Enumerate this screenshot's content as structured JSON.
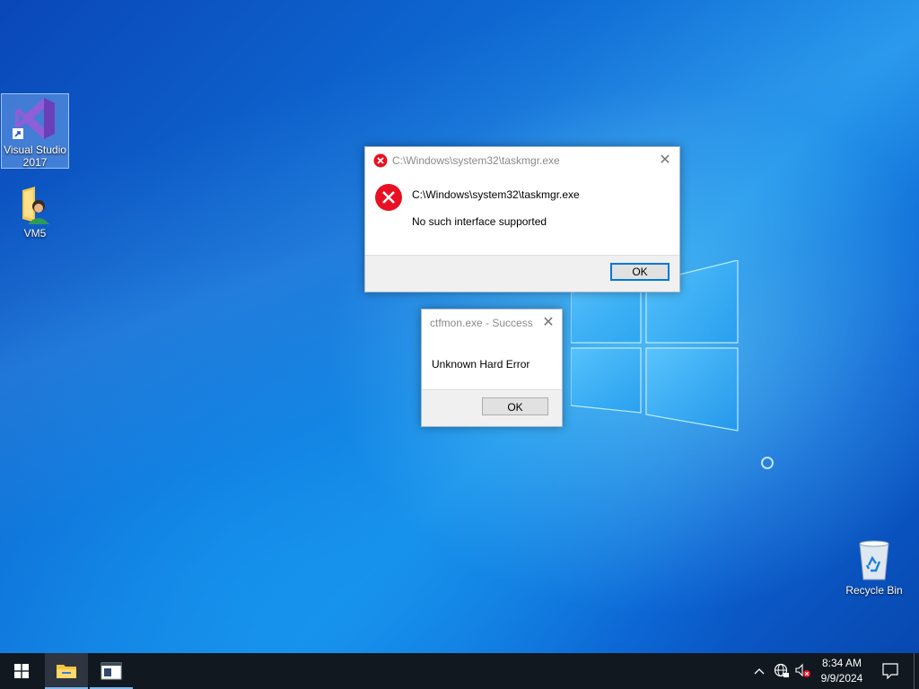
{
  "desktop": {
    "icons": [
      {
        "label_line1": "Visual Studio",
        "label_line2": "2017",
        "icon": "visual-studio-icon"
      },
      {
        "label": "VM5",
        "icon": "folder-user-icon"
      },
      {
        "label": "Recycle Bin",
        "icon": "recycle-bin-icon"
      }
    ]
  },
  "dialog_main": {
    "title": "C:\\Windows\\system32\\taskmgr.exe",
    "message_line1": "C:\\Windows\\system32\\taskmgr.exe",
    "message_line2": "No such interface supported",
    "ok_label": "OK",
    "icon": "error-icon"
  },
  "dialog_ctfmon": {
    "title": "ctfmon.exe - Success",
    "message": "Unknown Hard Error",
    "ok_label": "OK"
  },
  "taskbar": {
    "start_icon": "windows-start-icon",
    "pinned": [
      "file-explorer-icon",
      "app-window-icon"
    ],
    "tray_icons": [
      "chevron-up-icon",
      "network-icon",
      "speaker-muted-icon"
    ],
    "time": "8:34 AM",
    "date": "9/9/2024",
    "notification_icon": "notification-icon"
  },
  "colors": {
    "accent": "#0078d7",
    "error_red": "#e81123",
    "taskbar": "#111820"
  }
}
